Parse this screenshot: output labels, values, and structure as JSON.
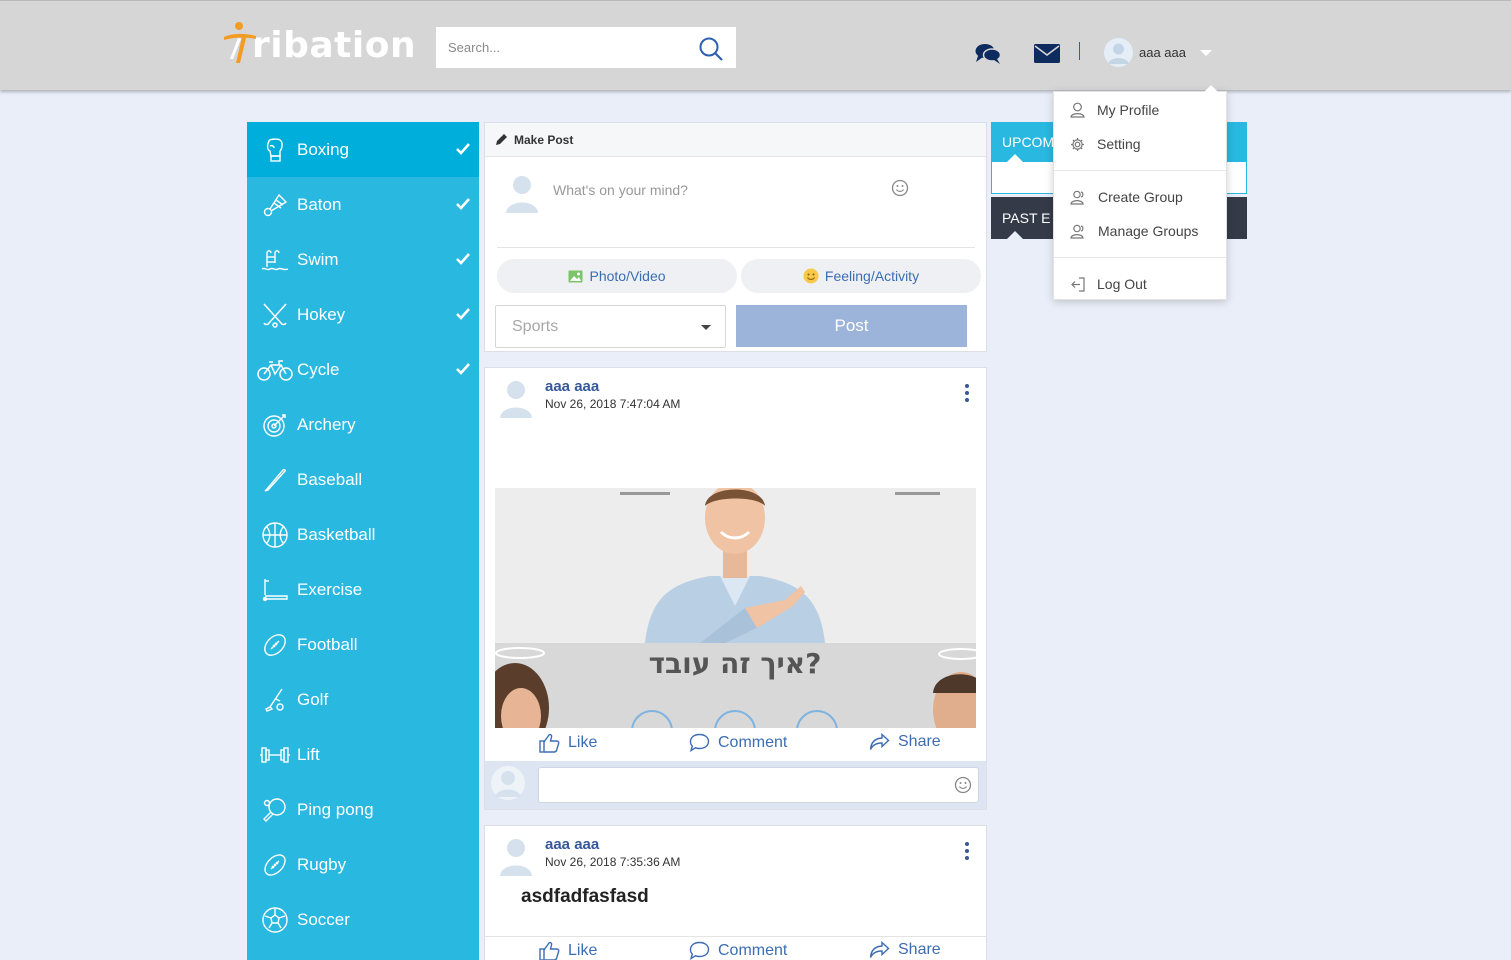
{
  "header": {
    "logo_text": "ribation",
    "search_placeholder": "Search...",
    "user_name": "aaa aaa",
    "icons": [
      "chat-icon",
      "mail-icon",
      "avatar",
      "chevron-down-icon"
    ]
  },
  "user_menu": {
    "items": [
      "My Profile",
      "Setting",
      "Create Group",
      "Manage Groups",
      "Log Out"
    ]
  },
  "sidebar": {
    "items": [
      {
        "label": "Boxing",
        "icon": "boxing-glove-icon",
        "checked": true
      },
      {
        "label": "Baton",
        "icon": "shuttlecock-icon",
        "checked": true
      },
      {
        "label": "Swim",
        "icon": "swimming-pool-icon",
        "checked": true
      },
      {
        "label": "Hokey",
        "icon": "hockey-sticks-icon",
        "checked": true
      },
      {
        "label": "Cycle",
        "icon": "bicycle-icon",
        "checked": true
      },
      {
        "label": "Archery",
        "icon": "target-icon",
        "checked": false
      },
      {
        "label": "Baseball",
        "icon": "bat-icon",
        "checked": false
      },
      {
        "label": "Basketball",
        "icon": "basketball-icon",
        "checked": false
      },
      {
        "label": "Exercise",
        "icon": "treadmill-icon",
        "checked": false
      },
      {
        "label": "Football",
        "icon": "football-icon",
        "checked": false
      },
      {
        "label": "Golf",
        "icon": "golf-icon",
        "checked": false
      },
      {
        "label": "Lift",
        "icon": "dumbbell-icon",
        "checked": false
      },
      {
        "label": "Ping pong",
        "icon": "ping-pong-icon",
        "checked": false
      },
      {
        "label": "Rugby",
        "icon": "rugby-ball-icon",
        "checked": false
      },
      {
        "label": "Soccer",
        "icon": "soccer-ball-icon",
        "checked": false
      }
    ]
  },
  "make_post": {
    "title": "Make Post",
    "placeholder": "What's on your mind?",
    "photo_label": "Photo/Video",
    "feeling_label": "Feeling/Activity",
    "sports_placeholder": "Sports",
    "post_label": "Post"
  },
  "posts": [
    {
      "author": "aaa aaa",
      "date": "Nov 26, 2018 7:47:04 AM",
      "image_caption": "איך זה עובד?",
      "like": "Like",
      "comment": "Comment",
      "share": "Share"
    },
    {
      "author": "aaa aaa",
      "date": "Nov 26, 2018 7:35:36 AM",
      "text": "asdfadfasfasd",
      "like": "Like",
      "comment": "Comment",
      "share": "Share"
    }
  ],
  "events": {
    "upcoming_label": "UPCOM",
    "past_label": "PAST E"
  },
  "colors": {
    "sidebar": "#29b8e0",
    "sidebar_active": "#00aedb",
    "header": "#d6d6d6",
    "accent_blue": "#3c6db3",
    "post_button": "#9cb4d9",
    "logo_orange": "#f39c24"
  }
}
